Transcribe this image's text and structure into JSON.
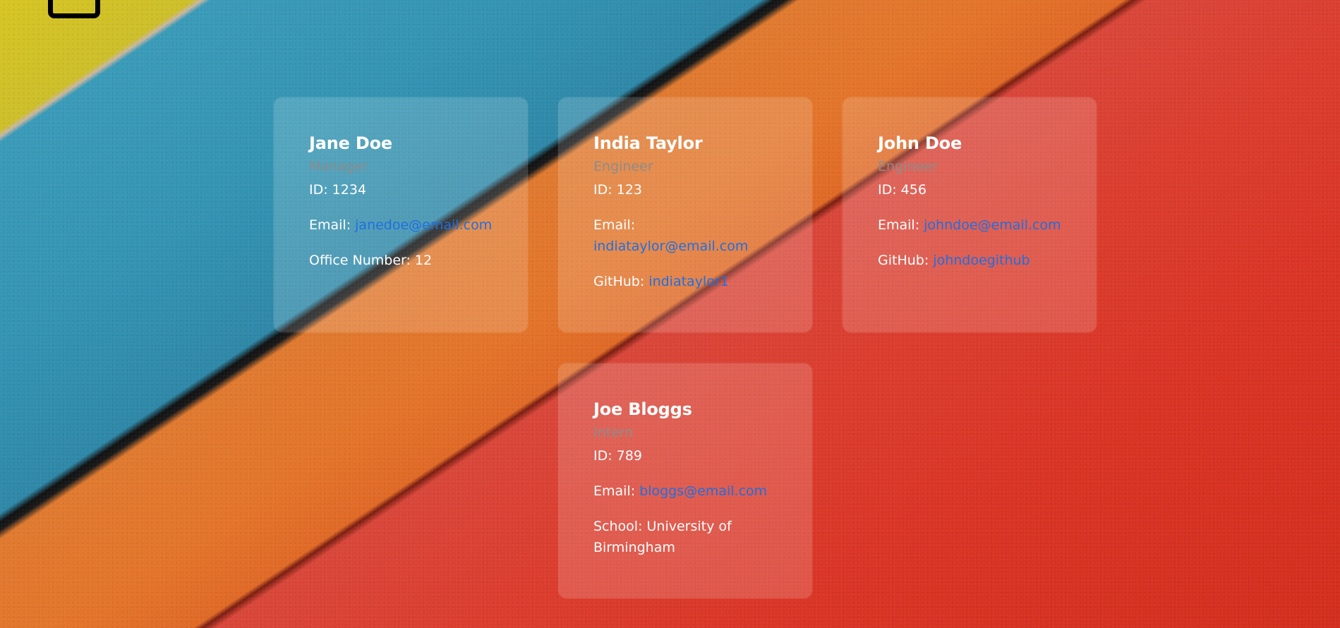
{
  "cards": [
    {
      "name": "Jane Doe",
      "role": "Manager",
      "id_label": "ID: 1234",
      "email_label": "Email: ",
      "email": "janedoe@email.com",
      "extra_label": "Office Number: 12"
    },
    {
      "name": "India Taylor",
      "role": "Engineer",
      "id_label": "ID: 123",
      "email_label": "Email:",
      "email": "indiataylor@email.com",
      "extra_label": "GitHub: ",
      "extra_link": "indiataylor1"
    },
    {
      "name": "John Doe",
      "role": "Engineer",
      "id_label": "ID: 456",
      "email_label": "Email: ",
      "email": "johndoe@email.com",
      "extra_label": "GitHub: ",
      "extra_link": "johndoegithub"
    },
    {
      "name": "Joe Bloggs",
      "role": "Intern",
      "id_label": "ID: 789",
      "email_label": "Email: ",
      "email": "bloggs@email.com",
      "extra_label": "School: University of Birmingham"
    }
  ],
  "colors": {
    "link": "#1f6fe0",
    "role": "#8c8c8c",
    "card_text": "#ffffff"
  }
}
